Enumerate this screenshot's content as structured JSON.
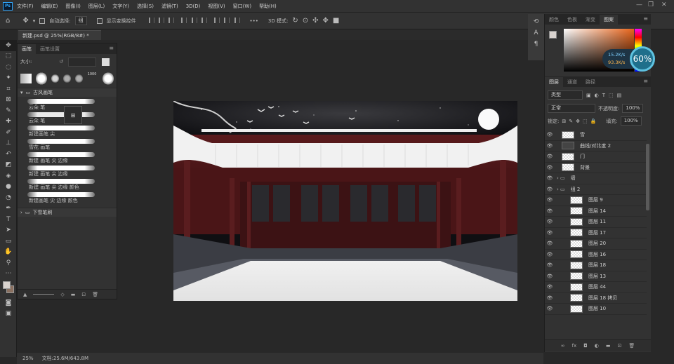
{
  "app": {
    "logo": "Ps"
  },
  "menu": [
    "文件(F)",
    "编辑(E)",
    "图像(I)",
    "图层(L)",
    "文字(Y)",
    "选择(S)",
    "滤镜(T)",
    "3D(D)",
    "视图(V)",
    "窗口(W)",
    "帮助(H)"
  ],
  "options": {
    "auto_select_label": "自动选择:",
    "auto_select_value": "组",
    "transform_label": "显示变换控件",
    "more": "•••",
    "mode_3d": "3D 模式:"
  },
  "document": {
    "tab_title": "新建.psd @ 25%(RGB/8#) *"
  },
  "brush_panel": {
    "tabs": [
      "画笔",
      "画笔设置"
    ],
    "size_label": "大小:",
    "groups": [
      {
        "label": "古风画笔",
        "expanded": true
      },
      {
        "label": "下雪笔刷",
        "expanded": false
      }
    ],
    "brushes": [
      "云朵 笔",
      "云朵 笔",
      "新建画笔 尖",
      "雪花 画笔",
      "新建 画笔 尖 边缘",
      "新建 画笔 尖 边缘",
      "新建 画笔 尖 边缘 颜色",
      "新建画笔 尖 边缘 颜色"
    ],
    "preset_size": "1000"
  },
  "color_panel": {
    "tabs": [
      "颜色",
      "色板",
      "渐变",
      "图案"
    ],
    "active": "颜色",
    "fg": "#d9d3cf",
    "bg": "#8a7060"
  },
  "net_monitor": {
    "up": "15.2K/s",
    "down": "93.3K/s",
    "percent": "60%"
  },
  "layers_panel": {
    "tabs": [
      "图层",
      "通道",
      "路径"
    ],
    "kind_label": "类型",
    "blend_mode": "正常",
    "opacity_label": "不透明度:",
    "opacity_value": "100%",
    "lock_label": "锁定:",
    "fill_label": "填充:",
    "fill_value": "100%",
    "layers": [
      {
        "name": "雪",
        "type": "layer",
        "indent": 0
      },
      {
        "name": "曲线/对比度 2",
        "type": "adjust",
        "indent": 0
      },
      {
        "name": "门",
        "type": "layer",
        "indent": 0
      },
      {
        "name": "背景",
        "type": "layer",
        "indent": 0
      },
      {
        "name": "墙",
        "type": "group",
        "indent": 0
      },
      {
        "name": "组 2",
        "type": "group",
        "indent": 0
      },
      {
        "name": "图层 9",
        "type": "layer",
        "indent": 1
      },
      {
        "name": "图层 14",
        "type": "layer",
        "indent": 1
      },
      {
        "name": "图层 11",
        "type": "layer",
        "indent": 1
      },
      {
        "name": "图层 17",
        "type": "layer",
        "indent": 1
      },
      {
        "name": "图层 20",
        "type": "layer",
        "indent": 1
      },
      {
        "name": "图层 16",
        "type": "layer",
        "indent": 1
      },
      {
        "name": "图层 18",
        "type": "layer",
        "indent": 1
      },
      {
        "name": "图层 13",
        "type": "layer",
        "indent": 1
      },
      {
        "name": "图层 44",
        "type": "layer",
        "indent": 1
      },
      {
        "name": "图层 18 拷贝",
        "type": "layer",
        "indent": 1
      },
      {
        "name": "图层 10",
        "type": "layer",
        "indent": 1
      }
    ]
  },
  "status": {
    "zoom": "25%",
    "doc_info": "文档:25.6M/643.8M"
  }
}
